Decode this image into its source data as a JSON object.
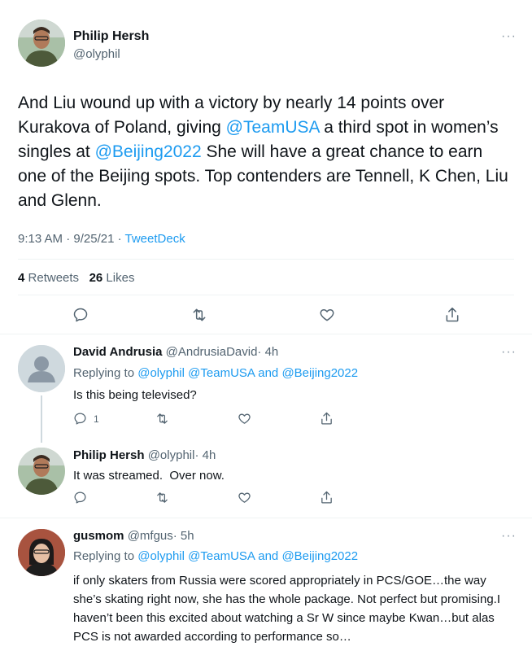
{
  "main_tweet": {
    "author_name": "Philip Hersh",
    "author_handle": "@olyphil",
    "text_parts": [
      "And Liu wound up with a victory by nearly 14 points over Kurakova of Poland, giving ",
      "@TeamUSA",
      " a third spot in women’s singles at ",
      "@Beijing2022",
      " She will have a great chance to earn one of the Beijing spots.  Top contenders are Tennell, K Chen, Liu and Glenn."
    ],
    "time": "9:13 AM",
    "date": "9/25/21",
    "sep": "·",
    "source": "TweetDeck",
    "retweets_count": "4",
    "retweets_label": "Retweets",
    "likes_count": "26",
    "likes_label": "Likes"
  },
  "replies": [
    {
      "name": "David Andrusia",
      "handle": "@AndrusiaDavid",
      "time": "· 4h",
      "replying_to": "Replying to",
      "mention1": "@olyphil",
      "mention2": "@TeamUSA",
      "and": "and",
      "mention3": "@Beijing2022",
      "text": "Is this being televised?",
      "reply_count": "1"
    },
    {
      "name": "Philip Hersh",
      "handle": "@olyphil",
      "time": "· 4h",
      "text": "It was streamed.  Over now."
    },
    {
      "name": "gusmom",
      "handle": "@mfgus",
      "time": "· 5h",
      "replying_to": "Replying to",
      "mention1": "@olyphil",
      "mention2": "@TeamUSA",
      "and": "and",
      "mention3": "@Beijing2022",
      "text": "if only skaters from Russia were scored appropriately in PCS/GOE…the way she’s skating right now, she has the whole package. Not perfect but promising.I haven’t been this excited about watching a Sr W since maybe Kwan…but alas PCS is not awarded according to performance so…"
    }
  ],
  "more_glyph": "···",
  "colors": {
    "link": "#1d9bf0",
    "muted": "#536471",
    "divider": "#eff3f4"
  }
}
